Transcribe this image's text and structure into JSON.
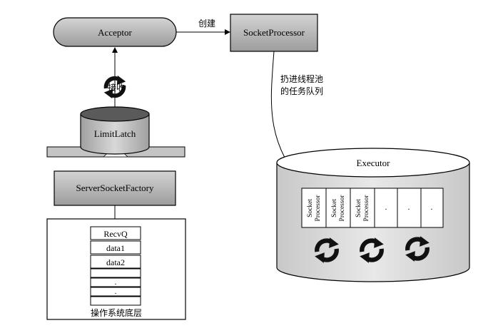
{
  "acceptor": {
    "label": "Acceptor"
  },
  "create_label": "创建",
  "socket_processor": {
    "label": "SocketProcessor"
  },
  "accept_label": "接收",
  "limit_latch": {
    "label": "LimitLatch"
  },
  "server_socket_factory": {
    "label": "ServerSocketFactory"
  },
  "queue": {
    "cells": [
      "RecvQ",
      "data1",
      "data2",
      "",
      ".",
      ".",
      ""
    ]
  },
  "os_label": "操作系统底层",
  "dispatch_label": {
    "line1": "扔进线程池",
    "line2": "的任务队列"
  },
  "executor": {
    "label": "Executor",
    "slots": [
      {
        "line1": "Socket",
        "line2": "Processor"
      },
      {
        "line1": "Socket",
        "line2": "Processor"
      },
      {
        "line1": "Socket",
        "line2": "Processor"
      },
      {
        "line1": ".",
        "line2": ""
      },
      {
        "line1": ".",
        "line2": ""
      },
      {
        "line1": ".",
        "line2": ""
      }
    ]
  },
  "icon_names": [
    "refresh-icon"
  ],
  "colors": {
    "box_fill": "#b8b8b8",
    "dark_fill": "#5a5a5a",
    "line": "#000000"
  }
}
